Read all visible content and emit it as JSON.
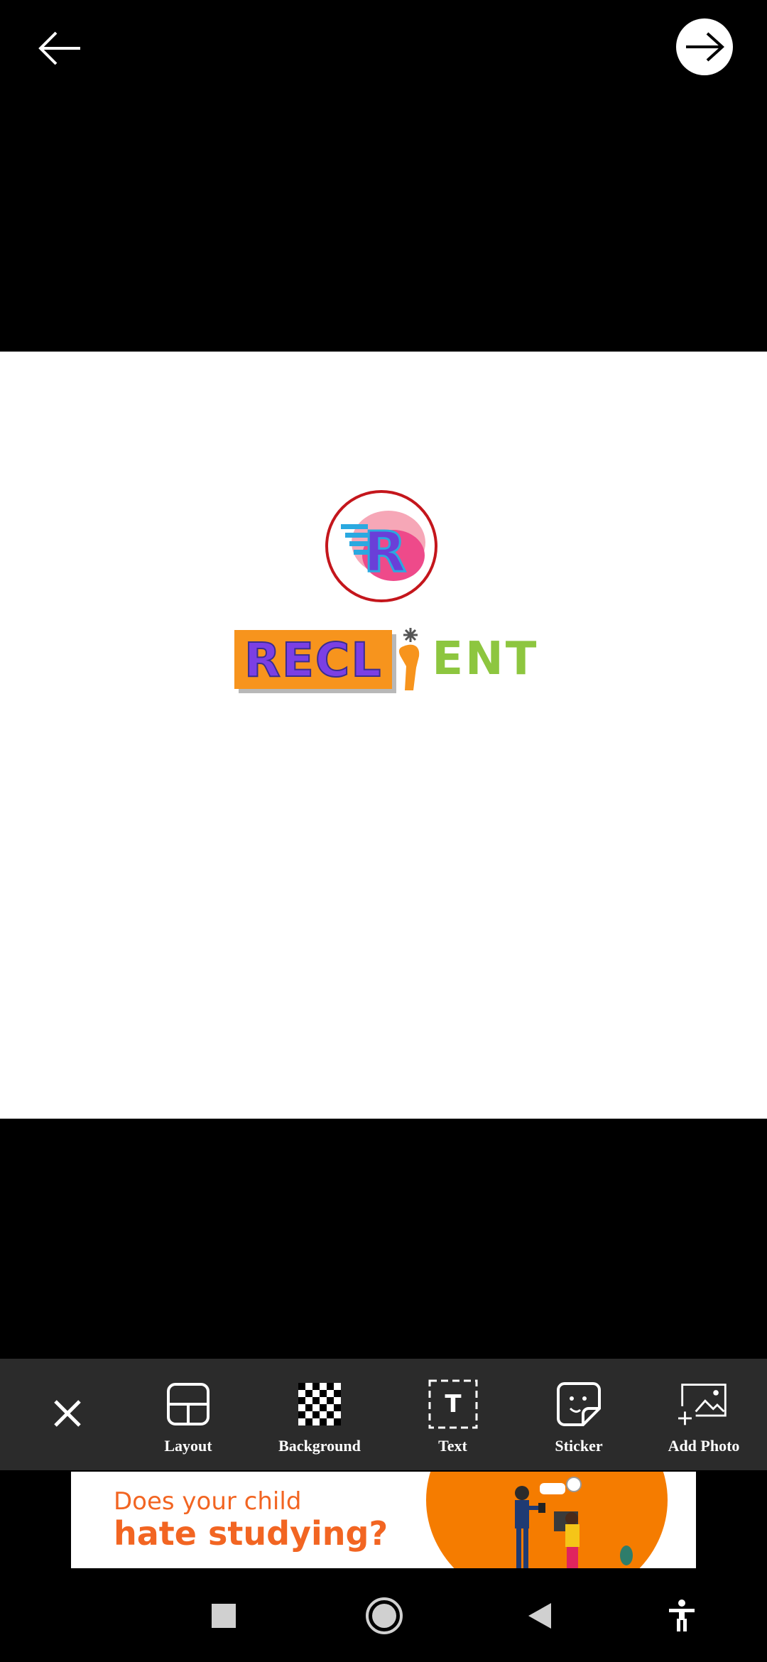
{
  "header": {
    "back_icon": "arrow-left-icon",
    "next_icon": "arrow-right-icon"
  },
  "canvas": {
    "logo": {
      "text_left": "RECL",
      "text_right": "ENT"
    }
  },
  "toolbar": {
    "close_icon": "close-icon",
    "items": [
      {
        "label": "Layout",
        "icon": "layout-icon"
      },
      {
        "label": "Background",
        "icon": "checkerboard-icon"
      },
      {
        "label": "Text",
        "icon": "text-icon"
      },
      {
        "label": "Sticker",
        "icon": "sticker-icon"
      },
      {
        "label": "Add Photo",
        "icon": "add-photo-icon"
      }
    ]
  },
  "ad": {
    "line1": "Does your child",
    "line2": "hate studying?"
  },
  "colors": {
    "accent_orange": "#f26522",
    "toolbar_bg": "#2b2b2b"
  }
}
